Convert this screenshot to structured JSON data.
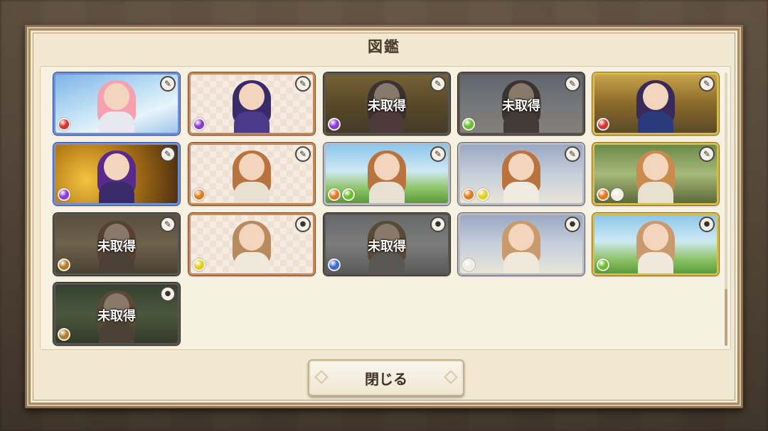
{
  "dialog": {
    "title": "図鑑",
    "close_label": "閉じる"
  },
  "locked_label": "未取得",
  "colors": {
    "red": "#d8322e",
    "purple": "#8a3ad6",
    "green": "#6abf2e",
    "orange": "#e07a1e",
    "yellow": "#e0cf1e",
    "blue": "#3a6ad6",
    "white": "#f1ece4",
    "brown": "#b07a2a"
  },
  "cards": [
    {
      "row": 0,
      "col": 0,
      "locked": false,
      "frame": "blue",
      "bg": "sky",
      "hair": "#f6a0b0",
      "body": "#e8e8f0",
      "orbs": [
        "red"
      ],
      "icon": "pen-icon"
    },
    {
      "row": 0,
      "col": 1,
      "locked": false,
      "frame": "copper",
      "bg": "checker",
      "hair": "#3a2a6a",
      "body": "#4a3a8a",
      "orbs": [
        "purple"
      ],
      "icon": "pen-icon"
    },
    {
      "row": 0,
      "col": 2,
      "locked": true,
      "frame": "dark",
      "bg": "gold",
      "hair": "#4a3a3a",
      "body": "#6a4a4a",
      "orbs": [
        "purple"
      ],
      "icon": "pen-icon"
    },
    {
      "row": 0,
      "col": 3,
      "locked": true,
      "frame": "dark",
      "bg": "town",
      "hair": "#4a3a3a",
      "body": "#5a4a4a",
      "orbs": [
        "green"
      ],
      "icon": "pen-icon"
    },
    {
      "row": 0,
      "col": 4,
      "locked": false,
      "frame": "gold",
      "bg": "gold",
      "hair": "#3a2a5a",
      "body": "#2a3a7a",
      "orbs": [
        "red"
      ],
      "icon": "pen-icon"
    },
    {
      "row": 1,
      "col": 0,
      "locked": false,
      "frame": "blue",
      "bg": "treasure",
      "hair": "#5a2a8a",
      "body": "#3a2a6a",
      "orbs": [
        "purple"
      ],
      "icon": "pen-icon"
    },
    {
      "row": 1,
      "col": 1,
      "locked": false,
      "frame": "copper",
      "bg": "checker",
      "hair": "#b9733e",
      "body": "#e8e0d0",
      "orbs": [
        "orange"
      ],
      "icon": "pen-icon"
    },
    {
      "row": 1,
      "col": 2,
      "locked": false,
      "frame": "silver",
      "bg": "meadow",
      "hair": "#b9733e",
      "body": "#e8e0d0",
      "orbs": [
        "orange",
        "green"
      ],
      "icon": "pen-icon"
    },
    {
      "row": 1,
      "col": 3,
      "locked": false,
      "frame": "silver",
      "bg": "town",
      "hair": "#b9733e",
      "body": "#f0eae0",
      "orbs": [
        "orange",
        "yellow"
      ],
      "icon": "pen-icon"
    },
    {
      "row": 1,
      "col": 4,
      "locked": false,
      "frame": "gold",
      "bg": "forest",
      "hair": "#c98a4e",
      "body": "#e8e0d0",
      "orbs": [
        "orange",
        "white"
      ],
      "icon": "pen-icon"
    },
    {
      "row": 2,
      "col": 0,
      "locked": true,
      "frame": "dark",
      "bg": "ruins",
      "hair": "#8a5a3a",
      "body": "#6a5a4a",
      "orbs": [
        "brown"
      ],
      "icon": "pen-icon"
    },
    {
      "row": 2,
      "col": 1,
      "locked": false,
      "frame": "copper",
      "bg": "checker",
      "hair": "#b98a5e",
      "body": "#f0e8da",
      "orbs": [
        "yellow"
      ],
      "icon": "mic-icon"
    },
    {
      "row": 2,
      "col": 2,
      "locked": true,
      "frame": "dark",
      "bg": "snow",
      "hair": "#8a6a4a",
      "body": "#8a8a8a",
      "orbs": [
        "blue"
      ],
      "icon": "mic-icon"
    },
    {
      "row": 2,
      "col": 3,
      "locked": false,
      "frame": "silver",
      "bg": "town",
      "hair": "#c99a6e",
      "body": "#f0e8da",
      "orbs": [
        "white"
      ],
      "icon": "mic-icon"
    },
    {
      "row": 2,
      "col": 4,
      "locked": false,
      "frame": "gold",
      "bg": "meadow",
      "hair": "#c99a6e",
      "body": "#f0e8da",
      "orbs": [
        "green"
      ],
      "icon": "mic-icon"
    },
    {
      "row": 3,
      "col": 0,
      "locked": true,
      "frame": "dark",
      "bg": "jungle",
      "hair": "#8a6a4a",
      "body": "#6a5a4a",
      "orbs": [
        "brown"
      ],
      "icon": "mic-icon"
    }
  ]
}
